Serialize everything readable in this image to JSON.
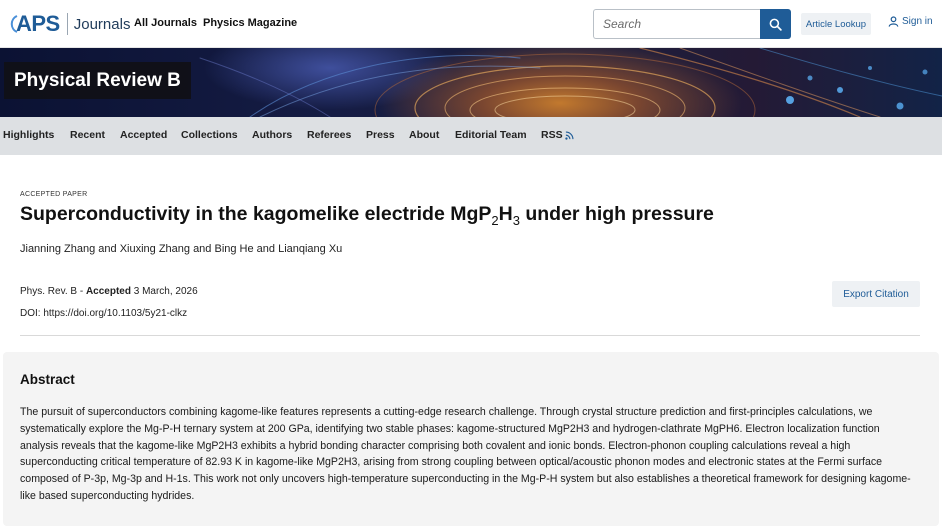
{
  "header": {
    "logo_brand": "APS",
    "logo_journals": "Journals",
    "nav_links": [
      "All Journals",
      "Physics Magazine"
    ],
    "search_placeholder": "Search",
    "article_lookup_label": "Article Lookup",
    "sign_in_label": "Sign in"
  },
  "banner": {
    "journal_title": "Physical Review B"
  },
  "subnav": {
    "items": [
      "Highlights",
      "Recent",
      "Accepted",
      "Collections",
      "Authors",
      "Referees",
      "Press",
      "About",
      "Editorial Team",
      "RSS"
    ]
  },
  "article": {
    "eyebrow": "ACCEPTED PAPER",
    "title_prefix": "Superconductivity in the kagomelike electride MgP",
    "title_sub1": "2",
    "title_mid": "H",
    "title_sub2": "3",
    "title_suffix": " under high pressure",
    "authors": "Jianning Zhang and Xiuxing Zhang and Bing He and Lianqiang Xu",
    "journal_ref": "Phys. Rev. B - ",
    "accepted_label": "Accepted",
    "accepted_date": " 3 March, 2026",
    "doi": "DOI: https://doi.org/10.1103/5y21-clkz",
    "export_citation_label": "Export Citation"
  },
  "abstract": {
    "heading": "Abstract",
    "text": "The pursuit of superconductors combining kagome-like features represents a cutting-edge research challenge. Through crystal structure prediction and first-principles calculations, we systematically explore the Mg-P-H ternary system at 200 GPa, identifying two stable phases: kagome-structured MgP2H3 and hydrogen-clathrate MgPH6. Electron localization function analysis reveals that the kagome-like MgP2H3 exhibits a hybrid bonding character comprising both covalent and ionic bonds. Electron-phonon coupling calculations reveal a high superconducting critical temperature of 82.93 K in kagome-like MgP2H3, arising from strong coupling between optical/acoustic phonon modes and electronic states at the Fermi surface composed of P-3p, Mg-3p and H-1s. This work not only uncovers high-temperature superconducting in the Mg-P-H system but also establishes a theoretical framework for designing kagome-like based superconducting hydrides."
  },
  "colors": {
    "brand_blue": "#1f5c97",
    "subnav_bg": "#dde0e3",
    "abstract_bg": "#f4f4f4",
    "rss_orange": "#e8862a"
  }
}
